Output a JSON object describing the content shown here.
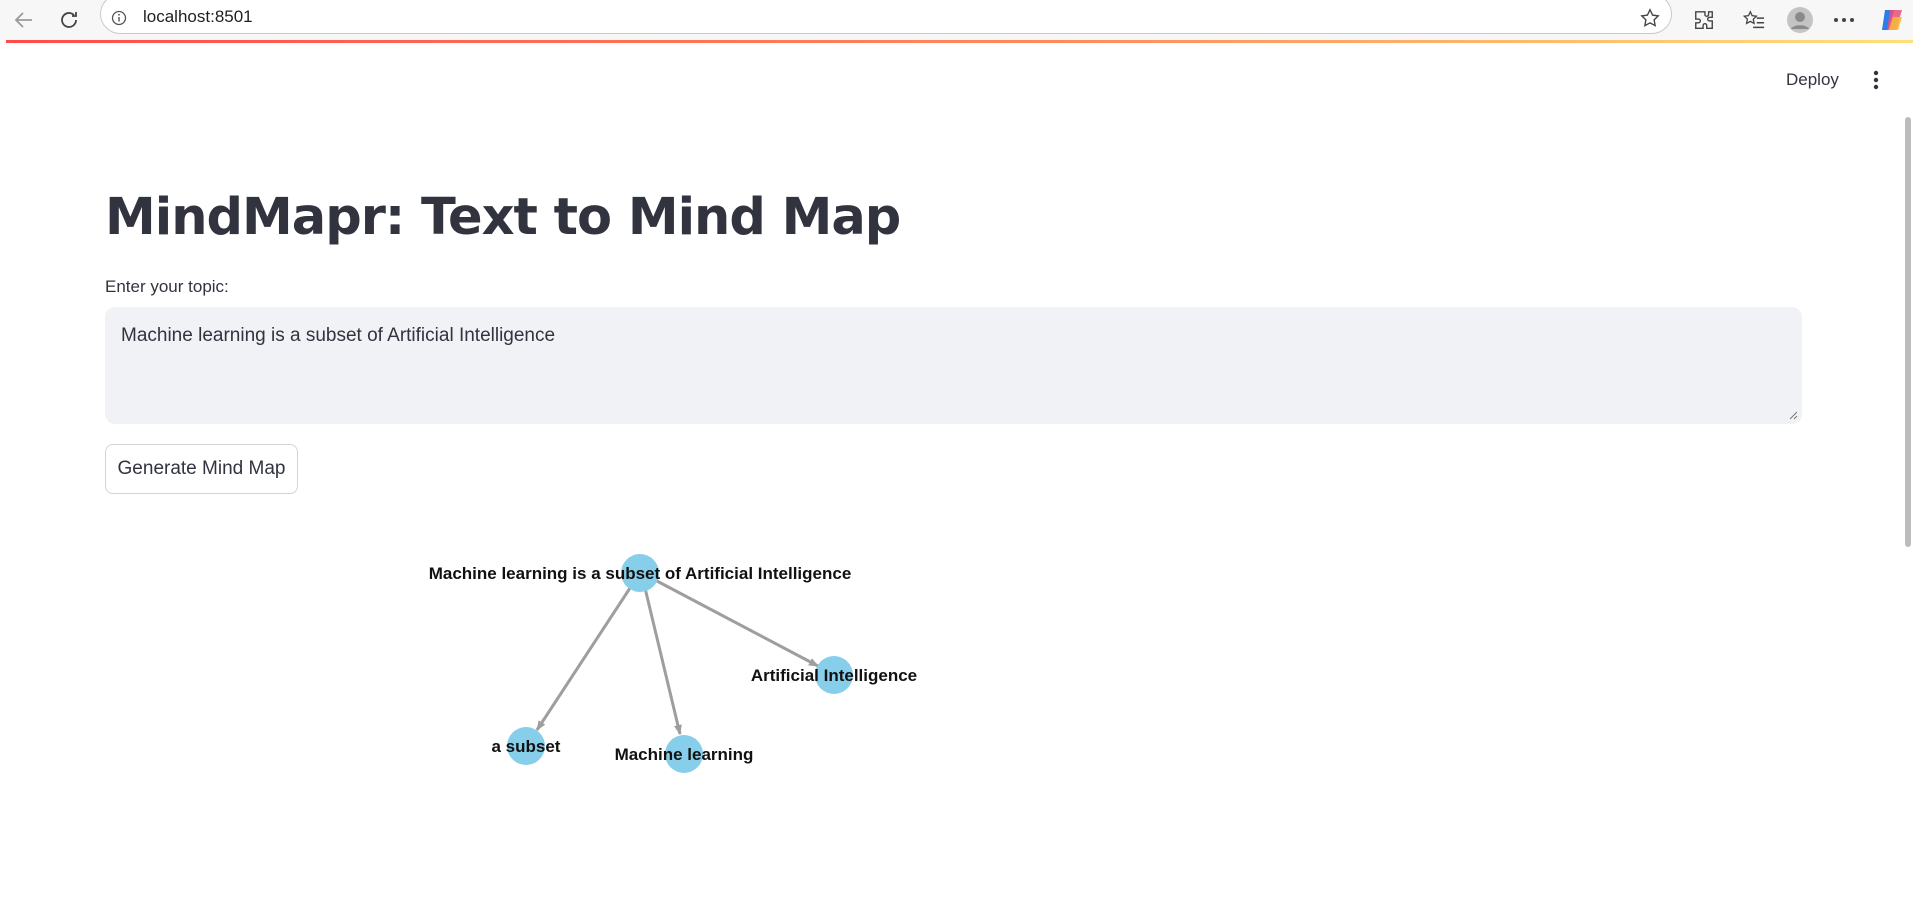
{
  "browser": {
    "url": "localhost:8501"
  },
  "app": {
    "deploy_label": "Deploy",
    "title": "MindMapr: Text to Mind Map",
    "topic_label": "Enter your topic:",
    "topic_value": "Machine learning is a subset of Artificial Intelligence",
    "generate_label": "Generate Mind Map"
  },
  "mindmap": {
    "root": "Machine learning is a subset of Artificial Intelligence",
    "children": [
      "a subset",
      "Machine learning",
      "Artificial Intelligence"
    ],
    "node_color": "#87ceeb",
    "edge_color": "#9e9e9e"
  },
  "colors": {
    "accent_gradient_start": "#ff4b4b",
    "accent_gradient_end": "#ffe07a",
    "text": "#31333f",
    "input_bg": "#f0f2f6"
  }
}
